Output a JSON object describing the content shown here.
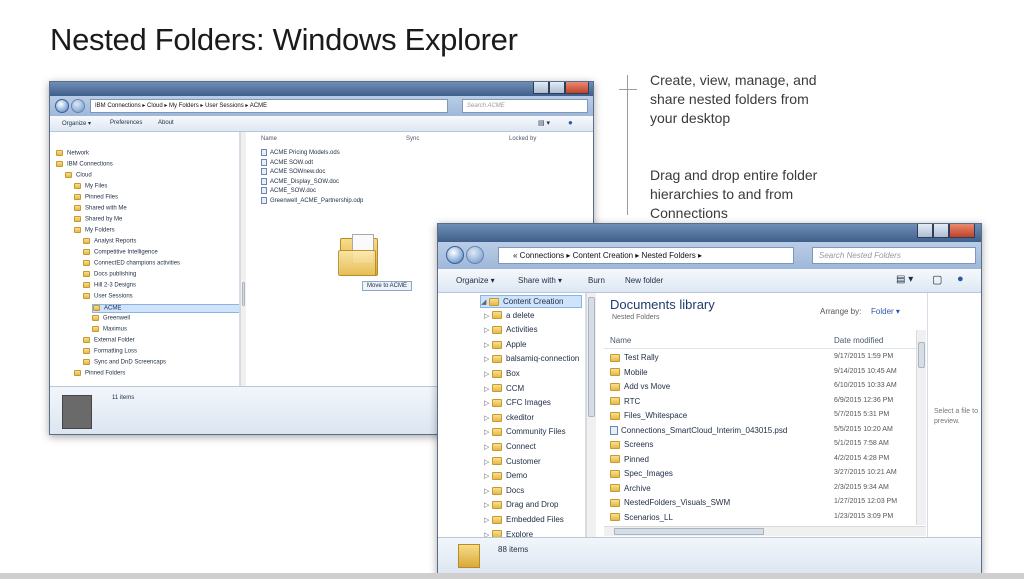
{
  "title": "Nested Folders: Windows Explorer",
  "callouts": [
    "Create, view, manage, and share nested folders from your desktop",
    "Drag and drop entire folder hierarchies to and from Connections"
  ],
  "win1": {
    "address": "IBM Connections  ▸  Cloud  ▸  My Folders  ▸  User Sessions  ▸  ACME",
    "search_placeholder": "Search ACME",
    "toolbar": {
      "organize": "Organize ▾",
      "preferences": "Preferences",
      "about": "About"
    },
    "nav": [
      {
        "label": "Network",
        "indent": 0
      },
      {
        "label": "IBM Connections",
        "indent": 0
      },
      {
        "label": "Cloud",
        "indent": 1
      },
      {
        "label": "My Files",
        "indent": 2
      },
      {
        "label": "Pinned Files",
        "indent": 2
      },
      {
        "label": "Shared with Me",
        "indent": 2
      },
      {
        "label": "Shared by Me",
        "indent": 2
      },
      {
        "label": "My Folders",
        "indent": 2
      },
      {
        "label": "Analyst Reports",
        "indent": 3
      },
      {
        "label": "Competitive Intelligence",
        "indent": 3
      },
      {
        "label": "ConnectED champions activities",
        "indent": 3
      },
      {
        "label": "Docs publishing",
        "indent": 3
      },
      {
        "label": "Hill 2-3 Designs",
        "indent": 3
      },
      {
        "label": "User Sessions",
        "indent": 3
      },
      {
        "label": "ACME",
        "indent": 4,
        "selected": true
      },
      {
        "label": "Greenwell",
        "indent": 4
      },
      {
        "label": "Maximus",
        "indent": 4
      },
      {
        "label": "External Folder",
        "indent": 3
      },
      {
        "label": "Formatting Loss",
        "indent": 3
      },
      {
        "label": "Sync and DnD Screencaps",
        "indent": 3
      },
      {
        "label": "Pinned Folders",
        "indent": 2
      }
    ],
    "columns": {
      "name": "Name",
      "sync": "Sync",
      "locked_by": "Locked by"
    },
    "files": [
      "ACME Pricing Models.ods",
      "ACME SOW.odt",
      "ACME SOWnew.doc",
      "ACME_Display_SOW.doc",
      "ACME_SOW.doc",
      "Greenwell_ACME_Partnership.odp"
    ],
    "drag_tooltip": "Move to ACME",
    "status": "11 items"
  },
  "win2": {
    "address": "«  Connections  ▸  Content Creation  ▸  Nested Folders  ▸",
    "search_placeholder": "Search Nested Folders",
    "toolbar": {
      "organize": "Organize ▾",
      "share": "Share with ▾",
      "burn": "Burn",
      "new_folder": "New folder"
    },
    "nav": [
      {
        "label": "Content Creation",
        "indent": 0,
        "selected": true
      },
      {
        "label": "a delete",
        "indent": 1
      },
      {
        "label": "Activities",
        "indent": 1
      },
      {
        "label": "Apple",
        "indent": 1
      },
      {
        "label": "balsamiq-connection",
        "indent": 1
      },
      {
        "label": "Box",
        "indent": 1
      },
      {
        "label": "CCM",
        "indent": 1
      },
      {
        "label": "CFC Images",
        "indent": 1
      },
      {
        "label": "ckeditor",
        "indent": 1
      },
      {
        "label": "Community Files",
        "indent": 1
      },
      {
        "label": "Connect",
        "indent": 1
      },
      {
        "label": "Customer",
        "indent": 1
      },
      {
        "label": "Demo",
        "indent": 1
      },
      {
        "label": "Docs",
        "indent": 1
      },
      {
        "label": "Drag and Drop",
        "indent": 1
      },
      {
        "label": "Embedded Files",
        "indent": 1
      },
      {
        "label": "Explore",
        "indent": 1
      }
    ],
    "library_title": "Documents library",
    "library_sub": "Nested Folders",
    "arrange_label": "Arrange by:",
    "arrange_value": "Folder ▾",
    "columns": {
      "name": "Name",
      "date": "Date modified"
    },
    "items": [
      {
        "name": "Test Rally",
        "date": "9/17/2015 1:59 PM"
      },
      {
        "name": "Mobile",
        "date": "9/14/2015 10:45 AM"
      },
      {
        "name": "Add vs Move",
        "date": "6/10/2015 10:33 AM"
      },
      {
        "name": "RTC",
        "date": "6/9/2015 12:36 PM"
      },
      {
        "name": "Files_Whitespace",
        "date": "5/7/2015 5:31 PM"
      },
      {
        "name": "Connections_SmartCloud_Interim_043015.psd",
        "date": "5/5/2015 10:20 AM"
      },
      {
        "name": "Screens",
        "date": "5/1/2015 7:58 AM"
      },
      {
        "name": "Pinned",
        "date": "4/2/2015 4:28 PM"
      },
      {
        "name": "Spec_Images",
        "date": "3/27/2015 10:21 AM"
      },
      {
        "name": "Archive",
        "date": "2/3/2015 9:34 AM"
      },
      {
        "name": "NestedFolders_Visuals_SWM",
        "date": "1/27/2015 12:03 PM"
      },
      {
        "name": "Scenarios_LL",
        "date": "1/23/2015 3:09 PM"
      }
    ],
    "preview": "Select a file to preview.",
    "status": "88 items"
  }
}
